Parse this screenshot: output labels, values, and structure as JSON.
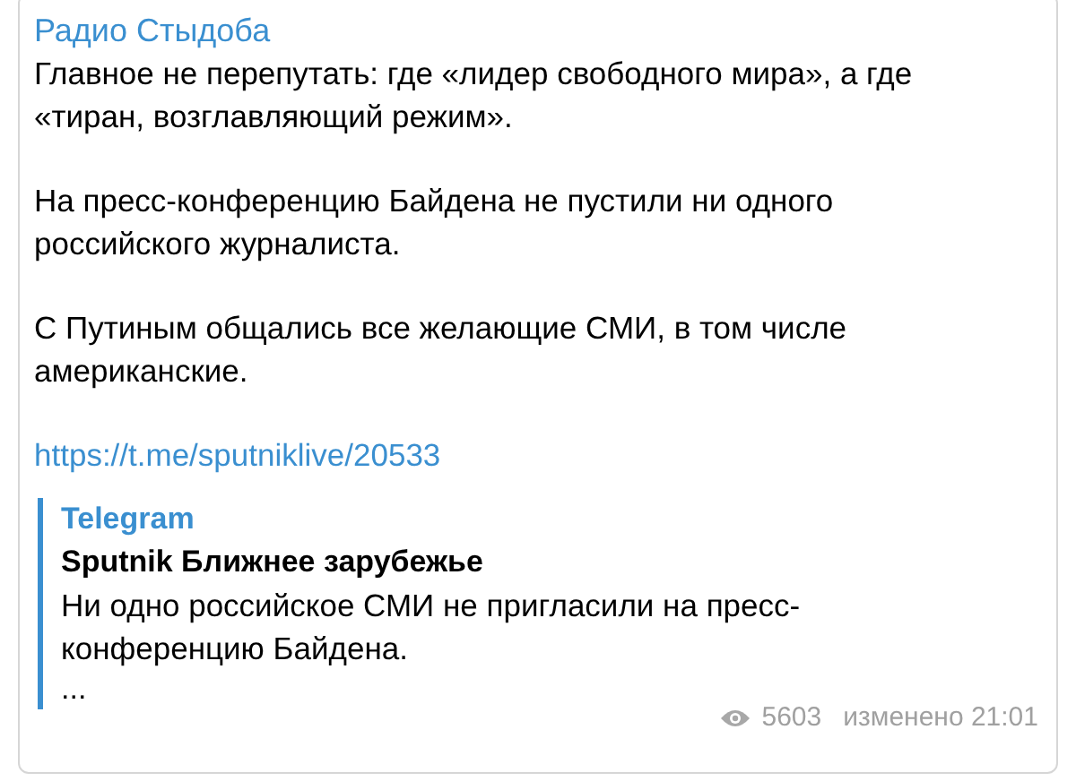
{
  "channel": {
    "name": "Радио Стыдоба"
  },
  "message": {
    "paragraphs": [
      "Главное не перепутать: где «лидер свободного мира», а где «тиран, возглавляющий режим».",
      "На пресс-конференцию Байдена не пустили ни одного российского журналиста.",
      "С Путиным общались все желающие СМИ, в том числе американские."
    ],
    "link": "https://t.me/sputniklive/20533"
  },
  "preview": {
    "site": "Telegram",
    "title": "Sputnik Ближнее зарубежье",
    "text": "Ни одно российское СМИ не пригласили на пресс-конференцию Байдена.",
    "ellipsis": "..."
  },
  "footer": {
    "views": "5603",
    "edited": "изменено 21:01"
  }
}
